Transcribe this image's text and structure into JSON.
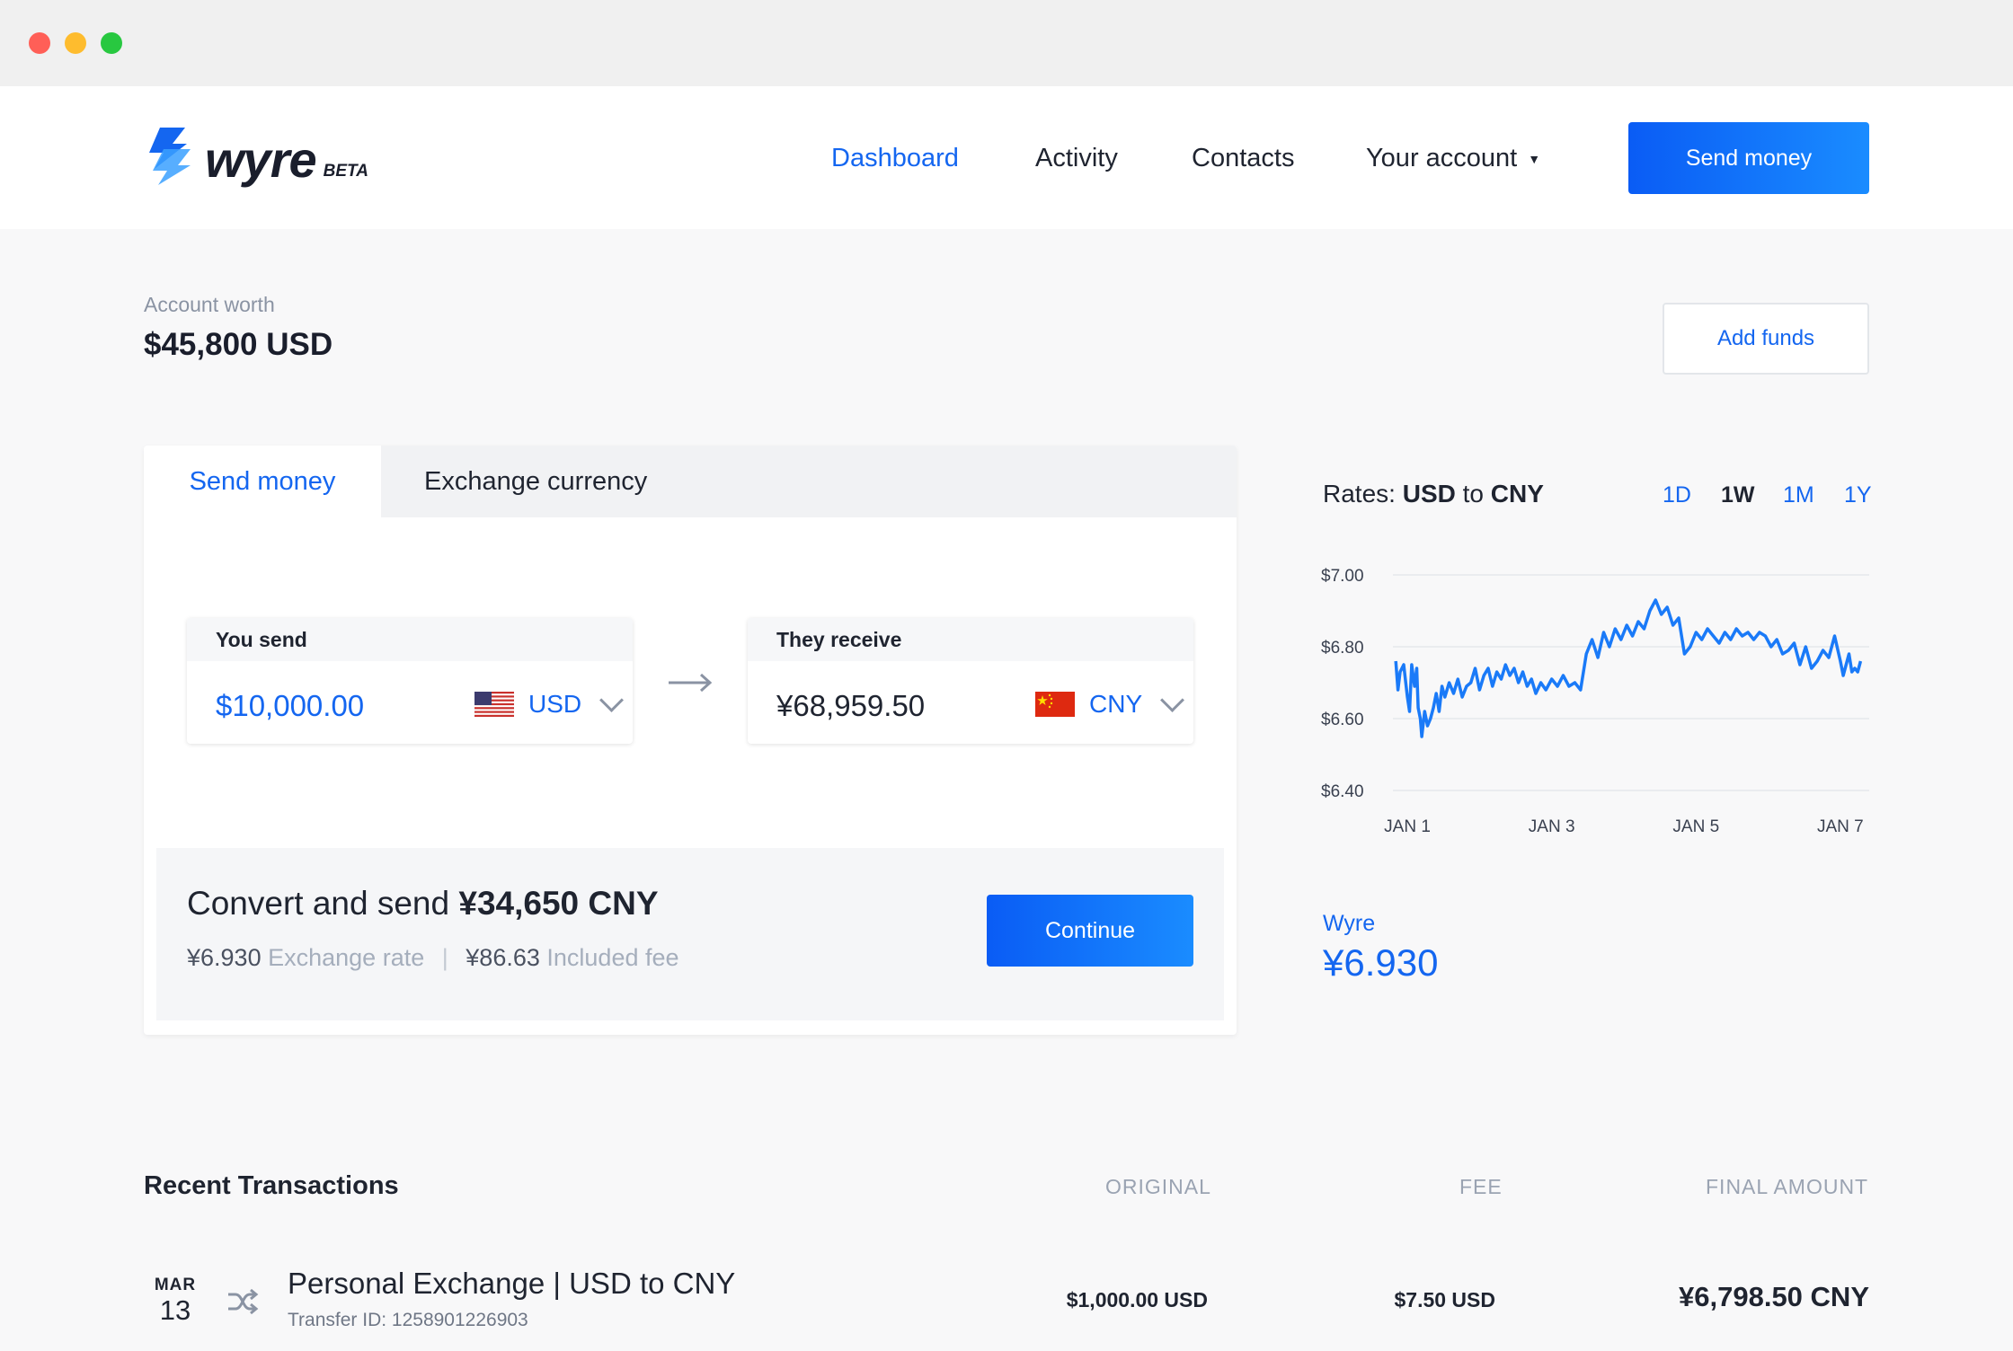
{
  "window": {
    "traffic_lights": [
      "#ff5f57",
      "#febc2e",
      "#28c840"
    ]
  },
  "brand": {
    "name": "wyre",
    "badge": "BETA",
    "logo_colors": [
      "#1466f0",
      "#3aa0ff",
      "#1a1e2c"
    ]
  },
  "nav": {
    "items": [
      {
        "label": "Dashboard",
        "active": true
      },
      {
        "label": "Activity",
        "active": false
      },
      {
        "label": "Contacts",
        "active": false
      },
      {
        "label": "Your account",
        "active": false,
        "has_dropdown": true
      }
    ],
    "cta_label": "Send money"
  },
  "account": {
    "label": "Account worth",
    "value": "$45,800 USD",
    "add_funds_label": "Add funds"
  },
  "transfer": {
    "tabs": [
      {
        "label": "Send money",
        "active": true
      },
      {
        "label": "Exchange currency",
        "active": false
      }
    ],
    "send": {
      "label": "You send",
      "amount": "$10,000.00",
      "currency": "USD",
      "flag": "us-flag-icon"
    },
    "receive": {
      "label": "They receive",
      "amount": "¥68,959.50",
      "currency": "CNY",
      "flag": "cn-flag-icon"
    },
    "summary": {
      "prefix": "Convert and send",
      "amount": "¥34,650 CNY",
      "rate_value": "¥6.930",
      "rate_label": "Exchange rate",
      "separator": "|",
      "fee_value": "¥86.63",
      "fee_label": "Included fee",
      "continue_label": "Continue"
    }
  },
  "rates": {
    "title_prefix": "Rates:",
    "from": "USD",
    "connector": "to",
    "to": "CNY",
    "ranges": [
      {
        "label": "1D",
        "selected": false
      },
      {
        "label": "1W",
        "selected": true
      },
      {
        "label": "1M",
        "selected": false
      },
      {
        "label": "1Y",
        "selected": false
      }
    ],
    "provider": "Wyre",
    "provider_rate": "¥6.930"
  },
  "chart_data": {
    "type": "line",
    "title": "",
    "xlabel": "",
    "ylabel": "",
    "ylim": [
      6.4,
      7.0
    ],
    "yticks": [
      "$7.00",
      "$6.80",
      "$6.60",
      "$6.40"
    ],
    "ytick_values": [
      7.0,
      6.8,
      6.6,
      6.4
    ],
    "xticks": [
      "JAN 1",
      "JAN 3",
      "JAN 5",
      "JAN 7"
    ],
    "xtick_values": [
      1,
      3,
      5,
      7
    ],
    "xlim": [
      0.8,
      7.4
    ],
    "grid": true,
    "line_color": "#1a7af8",
    "series": [
      {
        "x": [
          0.84,
          0.87,
          0.9,
          0.95,
          1.0,
          1.03,
          1.06,
          1.1,
          1.13,
          1.15,
          1.18,
          1.2,
          1.24,
          1.28,
          1.32,
          1.36,
          1.4,
          1.44,
          1.48,
          1.52,
          1.58,
          1.64,
          1.7,
          1.76,
          1.82,
          1.88,
          1.94,
          2.0,
          2.06,
          2.12,
          2.18,
          2.24,
          2.3,
          2.36,
          2.42,
          2.48,
          2.54,
          2.6,
          2.66,
          2.72,
          2.78,
          2.85,
          2.92,
          3.0,
          3.08,
          3.16,
          3.24,
          3.32,
          3.4,
          3.48,
          3.56,
          3.64,
          3.72,
          3.8,
          3.88,
          3.96,
          4.04,
          4.12,
          4.2,
          4.28,
          4.36,
          4.44,
          4.52,
          4.6,
          4.68,
          4.76,
          4.84,
          4.92,
          5.0,
          5.08,
          5.16,
          5.24,
          5.32,
          5.4,
          5.48,
          5.56,
          5.64,
          5.72,
          5.8,
          5.88,
          5.96,
          6.04,
          6.12,
          6.2,
          6.28,
          6.36,
          6.44,
          6.52,
          6.6,
          6.68,
          6.76,
          6.84,
          6.92,
          7.0,
          7.04,
          7.08,
          7.12,
          7.16,
          7.2,
          7.24,
          7.28
        ],
        "y": [
          6.76,
          6.68,
          6.73,
          6.75,
          6.66,
          6.62,
          6.75,
          6.69,
          6.74,
          6.63,
          6.6,
          6.55,
          6.62,
          6.58,
          6.6,
          6.63,
          6.67,
          6.62,
          6.69,
          6.66,
          6.7,
          6.67,
          6.71,
          6.66,
          6.69,
          6.7,
          6.74,
          6.68,
          6.72,
          6.74,
          6.69,
          6.73,
          6.71,
          6.75,
          6.72,
          6.74,
          6.7,
          6.73,
          6.69,
          6.71,
          6.67,
          6.7,
          6.68,
          6.71,
          6.69,
          6.72,
          6.69,
          6.7,
          6.68,
          6.78,
          6.82,
          6.77,
          6.84,
          6.8,
          6.85,
          6.82,
          6.86,
          6.83,
          6.87,
          6.85,
          6.9,
          6.93,
          6.89,
          6.91,
          6.86,
          6.88,
          6.78,
          6.8,
          6.84,
          6.82,
          6.85,
          6.83,
          6.81,
          6.84,
          6.82,
          6.85,
          6.83,
          6.84,
          6.82,
          6.84,
          6.83,
          6.8,
          6.82,
          6.78,
          6.79,
          6.81,
          6.75,
          6.8,
          6.74,
          6.76,
          6.79,
          6.77,
          6.83,
          6.76,
          6.72,
          6.75,
          6.78,
          6.73,
          6.74,
          6.73,
          6.76
        ]
      }
    ]
  },
  "transactions": {
    "title": "Recent Transactions",
    "columns": [
      "ORIGINAL",
      "FEE",
      "FINAL AMOUNT"
    ],
    "rows": [
      {
        "month": "MAR",
        "day": "13",
        "icon": "shuffle-icon",
        "title": "Personal Exchange | USD to CNY",
        "subtitle": "Transfer ID: 1258901226903",
        "original": "$1,000.00 USD",
        "fee": "$7.50 USD",
        "final": "¥6,798.50 CNY"
      }
    ]
  }
}
